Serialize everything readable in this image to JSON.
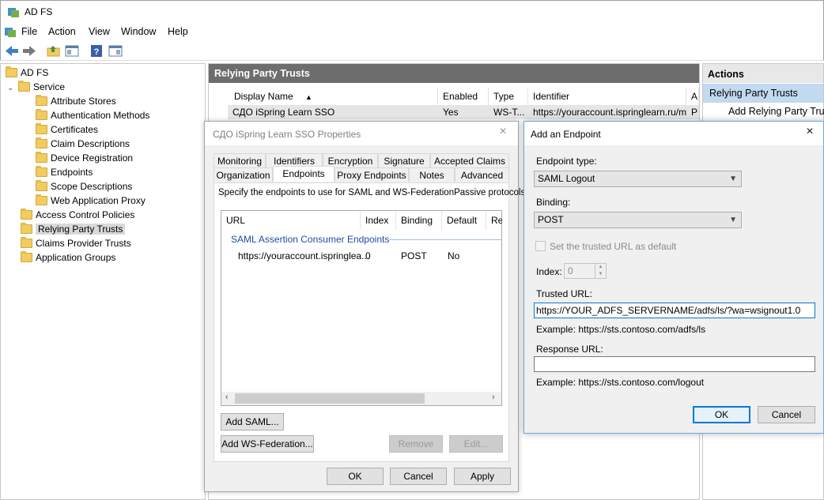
{
  "window": {
    "title": "AD FS"
  },
  "menu": [
    "File",
    "Action",
    "View",
    "Window",
    "Help"
  ],
  "tree": {
    "root": "AD FS",
    "service": "Service",
    "service_children": [
      "Attribute Stores",
      "Authentication Methods",
      "Certificates",
      "Claim Descriptions",
      "Device Registration",
      "Endpoints",
      "Scope Descriptions",
      "Web Application Proxy"
    ],
    "top_items": [
      "Access Control Policies",
      "Relying Party Trusts",
      "Claims Provider Trusts",
      "Application Groups"
    ],
    "selected": "Relying Party Trusts"
  },
  "center": {
    "header": "Relying Party Trusts",
    "columns": [
      "Display Name",
      "Enabled",
      "Type",
      "Identifier",
      "A"
    ],
    "rows": [
      {
        "name": "СДО iSpring Learn SSO",
        "enabled": "Yes",
        "type": "WS-T...",
        "identifier": "https://youraccount.ispringlearn.ru/m...",
        "a": "P"
      }
    ]
  },
  "actions": {
    "header": "Actions",
    "section": "Relying Party Trusts",
    "items": [
      "Add Relying Party Trust..."
    ]
  },
  "props_dialog": {
    "title": "СДО iSpring Learn SSO Properties",
    "tabs_row1": [
      "Monitoring",
      "Identifiers",
      "Encryption",
      "Signature",
      "Accepted Claims"
    ],
    "tabs_row2": [
      "Organization",
      "Endpoints",
      "Proxy Endpoints",
      "Notes",
      "Advanced"
    ],
    "active_tab": "Endpoints",
    "description": "Specify the endpoints to use for SAML and WS-FederationPassive protocols.",
    "list_columns": [
      "URL",
      "Index",
      "Binding",
      "Default",
      "Re"
    ],
    "group_label": "SAML Assertion Consumer Endpoints",
    "list_rows": [
      {
        "url": "https://youraccount.ispringlea...",
        "index": "0",
        "binding": "POST",
        "default": "No"
      }
    ],
    "buttons": {
      "add_saml": "Add SAML...",
      "add_wsfed": "Add WS-Federation...",
      "remove": "Remove",
      "edit": "Edit...",
      "ok": "OK",
      "cancel": "Cancel",
      "apply": "Apply"
    }
  },
  "endpoint_dialog": {
    "title": "Add an Endpoint",
    "endpoint_type_label": "Endpoint type:",
    "endpoint_type_value": "SAML Logout",
    "binding_label": "Binding:",
    "binding_value": "POST",
    "checkbox_label": "Set the trusted URL as default",
    "checkbox_checked": false,
    "index_label": "Index:",
    "index_value": "0",
    "trusted_url_label": "Trusted URL:",
    "trusted_url_value": "https://YOUR_ADFS_SERVERNAME/adfs/ls/?wa=wsignout1.0",
    "trusted_example": "Example: https://sts.contoso.com/adfs/ls",
    "response_url_label": "Response URL:",
    "response_url_value": "",
    "response_example": "Example: https://sts.contoso.com/logout",
    "ok": "OK",
    "cancel": "Cancel"
  },
  "colors": {
    "header_bg": "#6d6d6d",
    "selection": "#c3d9f0",
    "focus": "#0078d7"
  }
}
